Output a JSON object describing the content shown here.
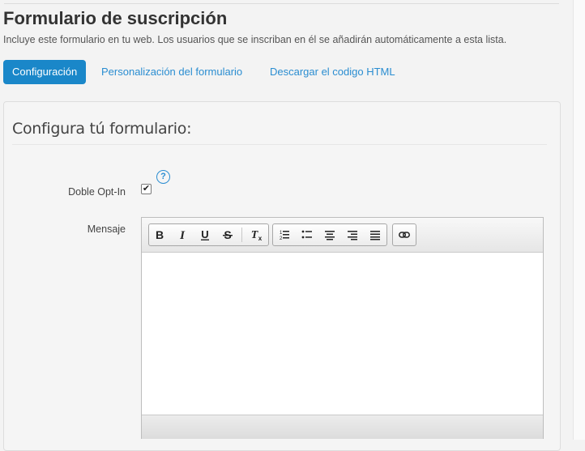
{
  "page": {
    "title": "Formulario de suscripción",
    "description": "Incluye este formulario en tu web. Los usuarios que se inscriban en él se añadirán automáticamente a esta lista."
  },
  "tabs": [
    {
      "label": "Configuración",
      "active": true
    },
    {
      "label": "Personalización del formulario",
      "active": false
    },
    {
      "label": "Descargar el codigo HTML",
      "active": false
    }
  ],
  "panel": {
    "title": "Configura tú formulario:",
    "double_opt_in": {
      "label": "Doble Opt-In",
      "checked": true,
      "checkmark": "✔",
      "help_glyph": "?"
    },
    "message": {
      "label": "Mensaje"
    }
  },
  "editor": {
    "toolbar_icons": [
      "bold-icon",
      "italic-icon",
      "underline-icon",
      "strikethrough-icon",
      "remove-format-icon",
      "numbered-list-icon",
      "bulleted-list-icon",
      "align-center-icon",
      "align-right-icon",
      "align-justify-icon",
      "link-icon"
    ],
    "content": ""
  },
  "colors": {
    "accent": "#1a87c9",
    "link": "#2a8dd1",
    "background": "#f3f3f3"
  }
}
